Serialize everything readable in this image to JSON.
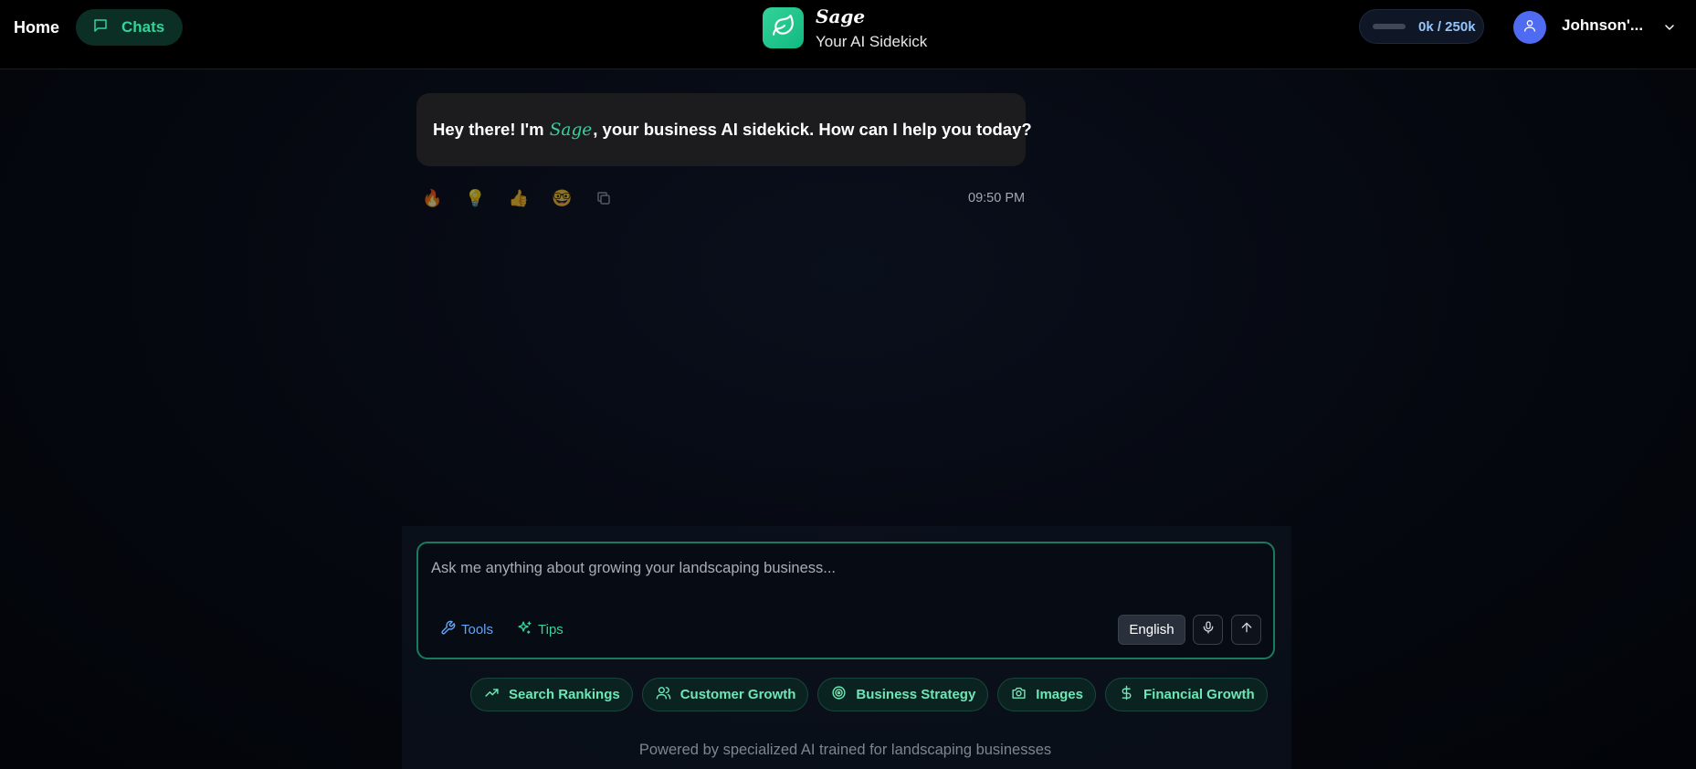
{
  "nav": {
    "home_label": "Home",
    "chats_label": "Chats"
  },
  "brand": {
    "name": "Sage",
    "tagline": "Your AI Sidekick",
    "accent_color": "#34d399"
  },
  "usage": {
    "text": "0k / 250k",
    "fraction": 0.0
  },
  "user": {
    "name": "Johnson'..."
  },
  "message": {
    "text_before": "Hey there! I'm ",
    "assistant_name": "Sage",
    "text_after": ", your business AI sidekick. How can I help you today?",
    "reactions": [
      "🔥",
      "💡",
      "👍",
      "🤓"
    ],
    "timestamp": "09:50 PM"
  },
  "composer": {
    "placeholder": "Ask me anything about growing your landscaping business...",
    "tools_label": "Tools",
    "tips_label": "Tips",
    "language": "English"
  },
  "suggestions": [
    {
      "label": "Search Rankings",
      "icon": "trending-up-icon"
    },
    {
      "label": "Customer Growth",
      "icon": "users-icon"
    },
    {
      "label": "Business Strategy",
      "icon": "target-icon"
    },
    {
      "label": "Images",
      "icon": "camera-icon"
    },
    {
      "label": "Financial Growth",
      "icon": "dollar-icon"
    }
  ],
  "footer": {
    "note": "Powered by specialized AI trained for landscaping businesses"
  }
}
